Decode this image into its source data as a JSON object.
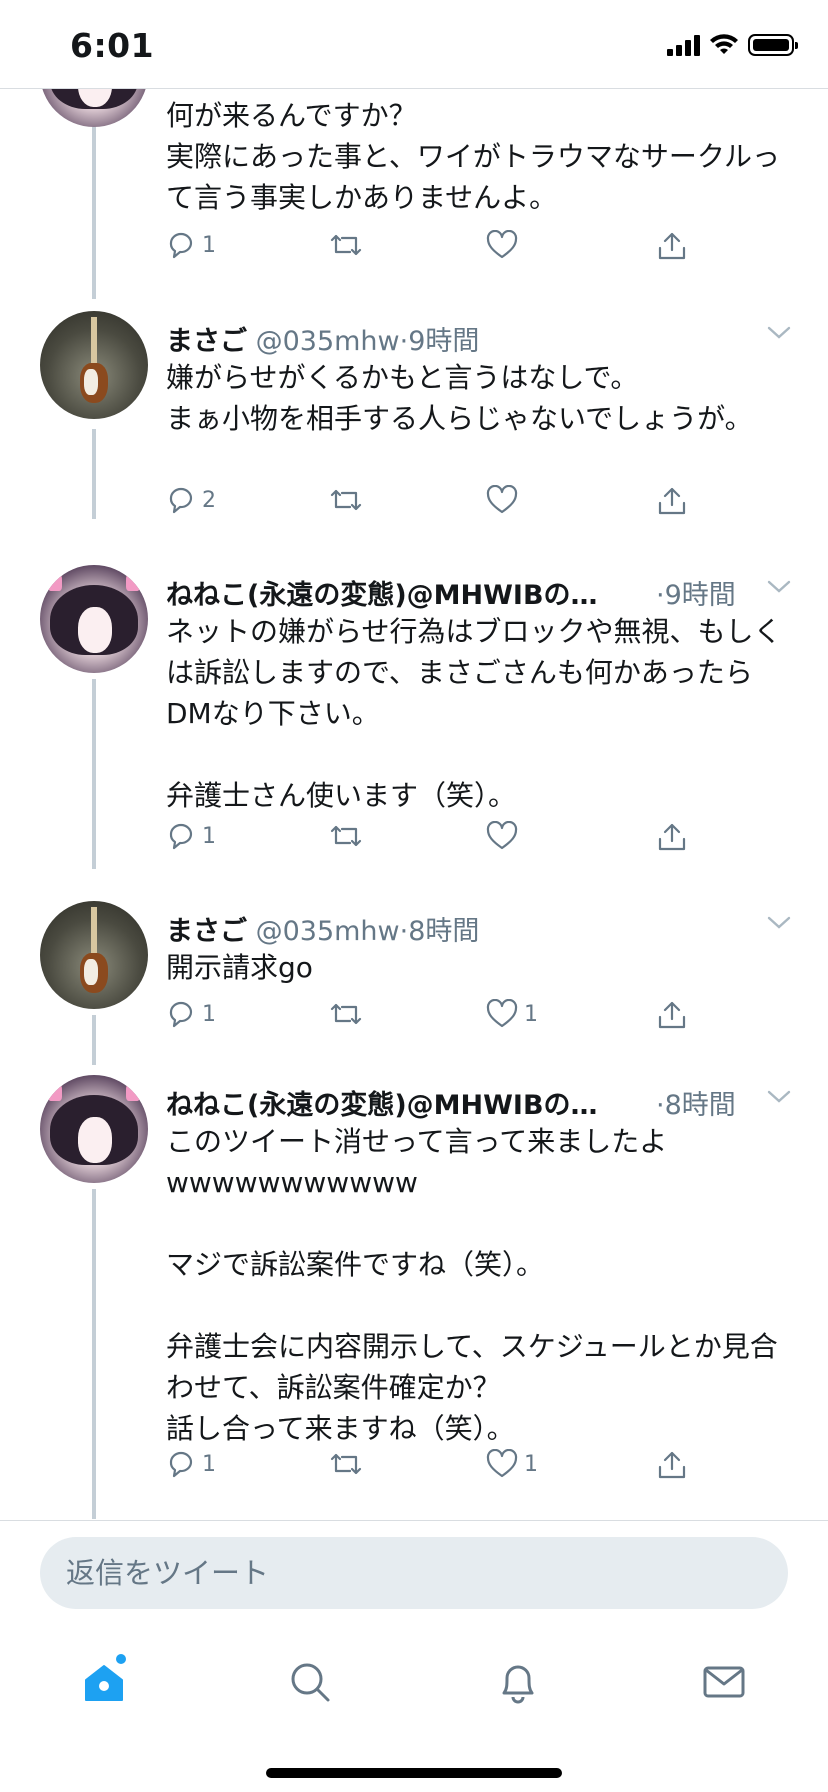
{
  "status_bar": {
    "time": "6:01"
  },
  "tweets": [
    {
      "body": "何が来るんですか？\n実際にあった事と、ワイがトラウマなサークルって言う事実しかありませんよ。",
      "reply_count": "1",
      "like_count": "",
      "avatar": "girl-avatar"
    },
    {
      "name": "まさご",
      "handle": "@035mhw",
      "time": "·9時間",
      "body": "嫌がらせがくるかもと言うはなしで。\nまぁ小物を相手する人らじゃないでしょうが。",
      "reply_count": "2",
      "like_count": "",
      "avatar": "guitar-avatar"
    },
    {
      "name": "ねねこ(永遠の変態)@MHWIBの…",
      "handle": "",
      "time": "·9時間",
      "body": "ネットの嫌がらせ行為はブロックや無視、もしくは訴訟しますので、まさごさんも何かあったらDMなり下さい。\n\n弁護士さん使います（笑）。",
      "reply_count": "1",
      "like_count": "",
      "avatar": "girl-avatar"
    },
    {
      "name": "まさご",
      "handle": "@035mhw",
      "time": "·8時間",
      "body": "開示請求go",
      "reply_count": "1",
      "like_count": "1",
      "avatar": "guitar-avatar"
    },
    {
      "name": "ねねこ(永遠の変態)@MHWIBの…",
      "handle": "",
      "time": "·8時間",
      "body": "このツイート消せって言って来ましたよ\nwwwwwwwwwww\n\nマジで訴訟案件ですね（笑）。\n\n弁護士会に内容開示して、スケジュールとか見合わせて、訴訟案件確定か？\n話し合って来ますね（笑）。",
      "reply_count": "1",
      "like_count": "1",
      "avatar": "girl-avatar"
    }
  ],
  "reply_bar": {
    "placeholder": "返信をツイート"
  },
  "tab_bar": {
    "items": [
      "home-icon",
      "search-icon",
      "notifications-icon",
      "messages-icon"
    ]
  },
  "colors": {
    "accent": "#1da1f2",
    "secondary_text": "#657786",
    "thread_line": "#c4ced6"
  }
}
